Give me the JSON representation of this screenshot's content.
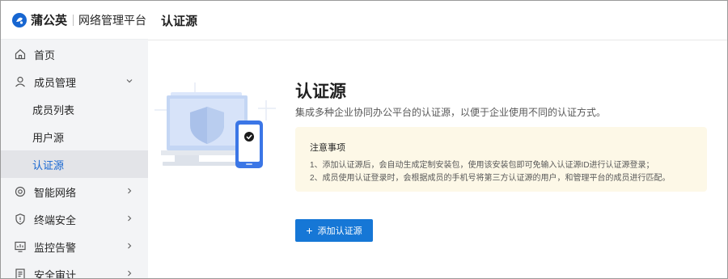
{
  "brand": {
    "name": "蒲公英",
    "subtitle": "网络管理平台"
  },
  "sidebar": {
    "items": [
      {
        "label": "首页",
        "icon": "home-icon"
      },
      {
        "label": "成员管理",
        "icon": "user-icon",
        "expanded": true,
        "children": [
          "成员列表",
          "用户源",
          "认证源"
        ],
        "active_child": "认证源"
      },
      {
        "label": "智能网络",
        "icon": "network-icon"
      },
      {
        "label": "终端安全",
        "icon": "shield-icon"
      },
      {
        "label": "监控告警",
        "icon": "monitor-icon"
      },
      {
        "label": "安全审计",
        "icon": "audit-icon"
      }
    ]
  },
  "topbar": {
    "title": "认证源"
  },
  "main": {
    "title": "认证源",
    "description": "集成多种企业协同办公平台的认证源，以便于企业使用不同的认证方式。",
    "notice": {
      "title": "注意事项",
      "lines": [
        "1、添加认证源后，会自动生成定制安装包，使用该安装包即可免输入认证源ID进行认证源登录；",
        "2、成员使用认证登录时，会根据成员的手机号将第三方认证源的用户，和管理平台的成员进行匹配。"
      ]
    },
    "add_button": {
      "icon": "+",
      "label": "添加认证源"
    }
  },
  "colors": {
    "accent": "#1677d6",
    "sidebar_bg": "#f3f4f6",
    "active_item_bg": "#e3e4e8",
    "active_item_text": "#1766d1",
    "notice_bg": "#fdf8e7"
  }
}
